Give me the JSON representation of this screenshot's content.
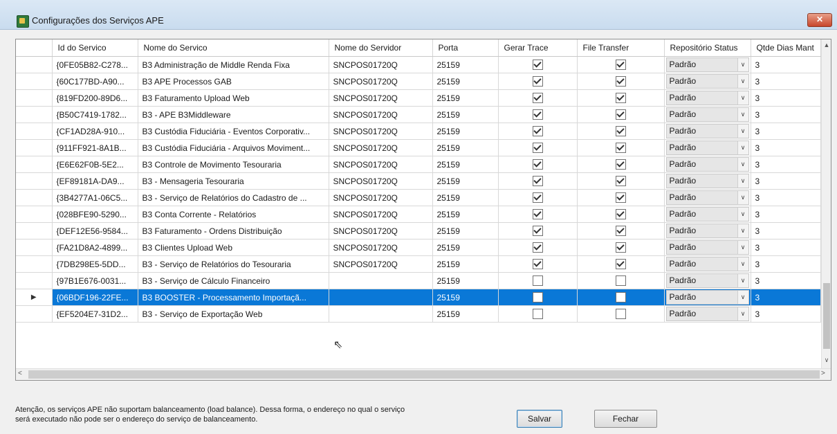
{
  "window": {
    "title": "Configurações dos Serviços APE",
    "close_label": "✕"
  },
  "grid": {
    "columns": [
      "",
      "Id do Servico",
      "Nome do Servico",
      "Nome do Servidor",
      "Porta",
      "Gerar Trace",
      "File Transfer",
      "Repositório Status",
      "Qtde Dias Mant"
    ],
    "rows": [
      {
        "id": "{0FE05B82-C278...",
        "nome": "B3 Administração de Middle Renda Fixa",
        "servidor": "SNCPOS01720Q",
        "porta": "25159",
        "trace": true,
        "transfer": true,
        "status": "Padrão",
        "dias": "3"
      },
      {
        "id": "{60C177BD-A90...",
        "nome": "B3 APE Processos GAB",
        "servidor": "SNCPOS01720Q",
        "porta": "25159",
        "trace": true,
        "transfer": true,
        "status": "Padrão",
        "dias": "3"
      },
      {
        "id": "{819FD200-89D6...",
        "nome": "B3 Faturamento Upload Web",
        "servidor": "SNCPOS01720Q",
        "porta": "25159",
        "trace": true,
        "transfer": true,
        "status": "Padrão",
        "dias": "3"
      },
      {
        "id": "{B50C7419-1782...",
        "nome": "B3 - APE B3Middleware",
        "servidor": "SNCPOS01720Q",
        "porta": "25159",
        "trace": true,
        "transfer": true,
        "status": "Padrão",
        "dias": "3"
      },
      {
        "id": "{CF1AD28A-910...",
        "nome": "B3 Custódia Fiduciária - Eventos Corporativ...",
        "servidor": "SNCPOS01720Q",
        "porta": "25159",
        "trace": true,
        "transfer": true,
        "status": "Padrão",
        "dias": "3"
      },
      {
        "id": "{911FF921-8A1B...",
        "nome": "B3 Custódia Fiduciária - Arquivos Moviment...",
        "servidor": "SNCPOS01720Q",
        "porta": "25159",
        "trace": true,
        "transfer": true,
        "status": "Padrão",
        "dias": "3"
      },
      {
        "id": "{E6E62F0B-5E2...",
        "nome": "B3 Controle de Movimento Tesouraria",
        "servidor": "SNCPOS01720Q",
        "porta": "25159",
        "trace": true,
        "transfer": true,
        "status": "Padrão",
        "dias": "3"
      },
      {
        "id": "{EF89181A-DA9...",
        "nome": "B3 - Mensageria Tesouraria",
        "servidor": "SNCPOS01720Q",
        "porta": "25159",
        "trace": true,
        "transfer": true,
        "status": "Padrão",
        "dias": "3"
      },
      {
        "id": "{3B4277A1-06C5...",
        "nome": "B3 - Serviço de Relatórios do Cadastro de ...",
        "servidor": "SNCPOS01720Q",
        "porta": "25159",
        "trace": true,
        "transfer": true,
        "status": "Padrão",
        "dias": "3"
      },
      {
        "id": "{028BFE90-5290...",
        "nome": "B3 Conta Corrente - Relatórios",
        "servidor": "SNCPOS01720Q",
        "porta": "25159",
        "trace": true,
        "transfer": true,
        "status": "Padrão",
        "dias": "3"
      },
      {
        "id": "{DEF12E56-9584...",
        "nome": "B3 Faturamento - Ordens Distribuição",
        "servidor": "SNCPOS01720Q",
        "porta": "25159",
        "trace": true,
        "transfer": true,
        "status": "Padrão",
        "dias": "3"
      },
      {
        "id": "{FA21D8A2-4899...",
        "nome": "B3 Clientes Upload Web",
        "servidor": "SNCPOS01720Q",
        "porta": "25159",
        "trace": true,
        "transfer": true,
        "status": "Padrão",
        "dias": "3"
      },
      {
        "id": "{7DB298E5-5DD...",
        "nome": "B3 - Serviço de Relatórios do Tesouraria",
        "servidor": "SNCPOS01720Q",
        "porta": "25159",
        "trace": true,
        "transfer": true,
        "status": "Padrão",
        "dias": "3"
      },
      {
        "id": "{97B1E676-0031...",
        "nome": "B3 - Serviço de Cálculo Financeiro",
        "servidor": "",
        "porta": "25159",
        "trace": false,
        "transfer": false,
        "status": "Padrão",
        "dias": "3"
      },
      {
        "id": "{06BDF196-22FE...",
        "nome": "B3 BOOSTER - Processamento Importaçã...",
        "servidor": "",
        "porta": "25159",
        "trace": false,
        "transfer": false,
        "status": "Padrão",
        "dias": "3",
        "selected": true,
        "marker": "▶"
      },
      {
        "id": "{EF5204E7-31D2...",
        "nome": "B3 - Serviço de Exportação Web",
        "servidor": "",
        "porta": "25159",
        "trace": false,
        "transfer": false,
        "status": "Padrão",
        "dias": "3"
      }
    ],
    "combo_arrow": "∨",
    "scroll_up": "▲",
    "scroll_down": "∨",
    "scroll_left": "<",
    "scroll_right": ">"
  },
  "footer": {
    "note_line1": "Atenção, os serviços APE não suportam balanceamento (load balance). Dessa forma, o endereço no qual o serviço",
    "note_line2": "será executado não pode ser o endereço do serviço de balanceamento.",
    "save_label": "Salvar",
    "close_label": "Fechar"
  },
  "colors": {
    "selection": "#0a78d7",
    "titlebar": "#c9dcef",
    "close_button": "#c7462b"
  }
}
